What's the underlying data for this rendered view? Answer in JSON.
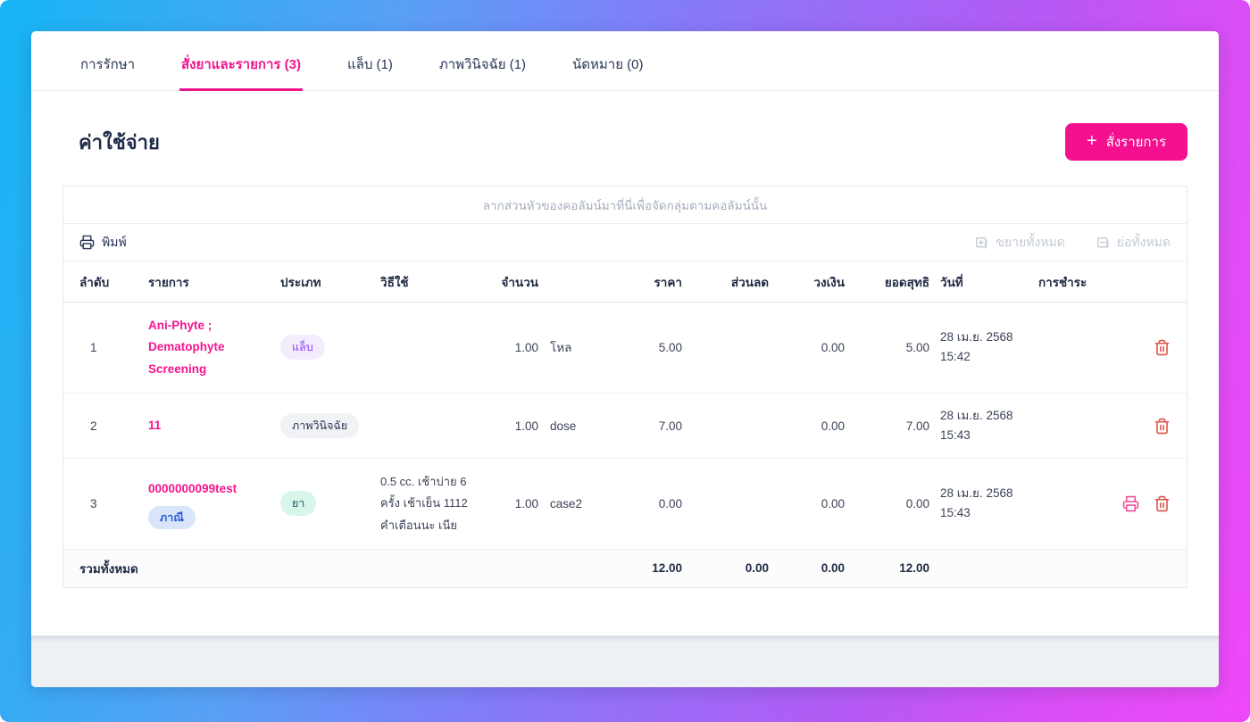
{
  "tabs": [
    {
      "label": "การรักษา",
      "state": ""
    },
    {
      "label": "สั่งยาและรายการ (3)",
      "state": "active"
    },
    {
      "label": "แล็บ (1)",
      "state": ""
    },
    {
      "label": "ภาพวินิจฉัย (1)",
      "state": ""
    },
    {
      "label": "นัดหมาย (0)",
      "state": ""
    }
  ],
  "page": {
    "title": "ค่าใช้จ่าย",
    "order_button_label": "สั่งรายการ",
    "order_button_plus": "+"
  },
  "grid": {
    "group_hint": "ลากส่วนหัวของคอลัมน์มาที่นี่เพื่อจัดกลุ่มตามคอลัมน์นั้น",
    "toolbar": {
      "print_label": "พิมพ์",
      "expand_all_label": "ขยายทั้งหมด",
      "collapse_all_label": "ย่อทั้งหมด"
    },
    "columns": [
      "ลำดับ",
      "รายการ",
      "ประเภท",
      "วิธีใช้",
      "จำนวน",
      "ราคา",
      "ส่วนลด",
      "วงเงิน",
      "ยอดสุทธิ",
      "วันที่",
      "การชำระ"
    ],
    "rows": [
      {
        "no": "1",
        "name": "Ani-Phyte ; Dematophyte Screening",
        "name_badge": "",
        "type": "แล็บ",
        "type_bg": "#f3ecfd",
        "type_fg": "#8b3dff",
        "usage": "",
        "qty": "1.00",
        "unit": "โหล",
        "price": "5.00",
        "discount": "",
        "credit": "0.00",
        "net": "5.00",
        "date": "28 เม.ย. 2568",
        "time": "15:42",
        "payment": "",
        "actions": [
          "delete"
        ]
      },
      {
        "no": "2",
        "name": "11",
        "name_badge": "",
        "type": "ภาพวินิจฉัย",
        "type_bg": "#f0f2f5",
        "type_fg": "#2a3655",
        "usage": "",
        "qty": "1.00",
        "unit": "dose",
        "price": "7.00",
        "discount": "",
        "credit": "0.00",
        "net": "7.00",
        "date": "28 เม.ย. 2568",
        "time": "15:43",
        "payment": "",
        "actions": [
          "delete"
        ]
      },
      {
        "no": "3",
        "name": "0000000099test",
        "name_badge": "ภาณี",
        "type": "ยา",
        "type_bg": "#d8f6ea",
        "type_fg": "#1d566b",
        "usage": "0.5 cc. เช้าบ่าย 6 ครั้ง เช้าเย็น 1112 คำเตือนนะ เนีย",
        "qty": "1.00",
        "unit": "case2",
        "price": "0.00",
        "discount": "",
        "credit": "0.00",
        "net": "0.00",
        "date": "28 เม.ย. 2568",
        "time": "15:43",
        "payment": "",
        "actions": [
          "print",
          "delete"
        ]
      }
    ],
    "footer": {
      "label": "รวมทั้งหมด",
      "price_total": "12.00",
      "discount_total": "0.00",
      "credit_total": "0.00",
      "net_total": "12.00"
    }
  },
  "colors": {
    "accent_pink": "#f5108f",
    "active_tab": "#f0148c",
    "delete_icon": "#dd5449",
    "row_print_icon": "#f04e98",
    "frame_gradient_start": "#15b5f3",
    "frame_gradient_end": "#ef48f8"
  }
}
